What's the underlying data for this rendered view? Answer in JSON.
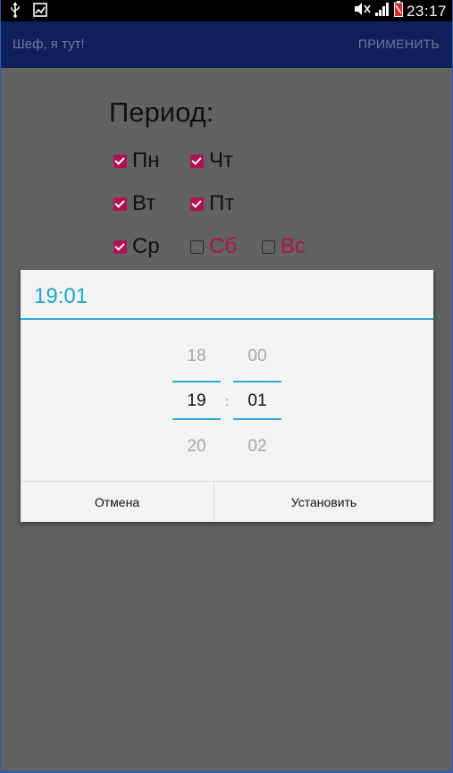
{
  "status_bar": {
    "time": "23:17",
    "icons": [
      "usb-icon",
      "gallery-icon",
      "mute-icon",
      "signal-icon",
      "battery-icon"
    ]
  },
  "action_bar": {
    "title": "Шеф, я тут!",
    "apply_label": "ПРИМЕНИТЬ"
  },
  "period": {
    "title": "Период:",
    "days": [
      {
        "label": "Пн",
        "checked": true,
        "weekend": false
      },
      {
        "label": "Чт",
        "checked": true,
        "weekend": false
      },
      {
        "label": "Вт",
        "checked": true,
        "weekend": false
      },
      {
        "label": "Пт",
        "checked": true,
        "weekend": false
      },
      {
        "label": "Ср",
        "checked": true,
        "weekend": false
      },
      {
        "label": "Сб",
        "checked": false,
        "weekend": true
      },
      {
        "label": "Вс",
        "checked": false,
        "weekend": true
      }
    ]
  },
  "time_dialog": {
    "title": "19:01",
    "hours": {
      "prev": "18",
      "current": "19",
      "next": "20"
    },
    "minutes": {
      "prev": "00",
      "current": "01",
      "next": "02"
    },
    "separator": ":",
    "cancel_label": "Отмена",
    "set_label": "Установить"
  },
  "colors": {
    "accent": "#1aa9d4",
    "checkbox": "#b0124e",
    "action_bar": "#0f1f5a",
    "scrim_background": "#626262"
  }
}
